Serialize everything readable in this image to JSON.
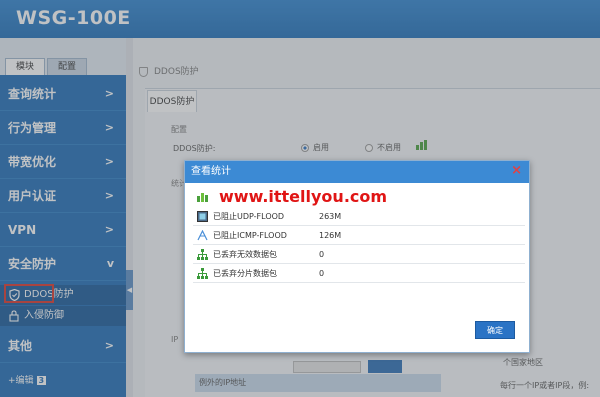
{
  "app": {
    "brand": "WSG-100E"
  },
  "sidebar": {
    "tabs": [
      "模块",
      "配置"
    ],
    "items": [
      {
        "label": "查询统计",
        "arrow": ">"
      },
      {
        "label": "行为管理",
        "arrow": ">"
      },
      {
        "label": "带宽优化",
        "arrow": ">"
      },
      {
        "label": "用户认证",
        "arrow": ">"
      },
      {
        "label": "VPN",
        "arrow": ">"
      },
      {
        "label": "安全防护",
        "arrow": "v"
      }
    ],
    "subitems": [
      "DDOS防护",
      "入侵防御"
    ],
    "other": {
      "label": "其他",
      "arrow": ">"
    },
    "edit_label": "+编辑",
    "edit_count": "3"
  },
  "main": {
    "breadcrumb": "DDOS防护",
    "tab": "DDOS防护",
    "section_config": "配置",
    "ddos_label": "DDOS防护:",
    "enable_label": "启用",
    "disable_label": "不启用",
    "section_stat": "统计",
    "ip_section": "IP",
    "region_text": "个国家地区",
    "hint_text": "每行一个IP或者IP段，例:",
    "table_header": "例外的IP地址"
  },
  "dialog": {
    "title": "查看统计",
    "watermark": "www.ittellyou.com",
    "rows": [
      {
        "label": "已阻止UDP-FLOOD",
        "value": "263M",
        "icon": "udp-icon"
      },
      {
        "label": "已阻止ICMP-FLOOD",
        "value": "126M",
        "icon": "icmp-icon"
      },
      {
        "label": "已丢弃无效数据包",
        "value": "0",
        "icon": "network-icon"
      },
      {
        "label": "已丢弃分片数据包",
        "value": "0",
        "icon": "network-icon"
      }
    ],
    "ok_label": "确定"
  },
  "colors": {
    "header": "#2f84cf",
    "sidebar": "#1f6db6",
    "dialog_head": "#3c8ad4",
    "watermark": "#e01515",
    "highlight": "#d9342b"
  }
}
